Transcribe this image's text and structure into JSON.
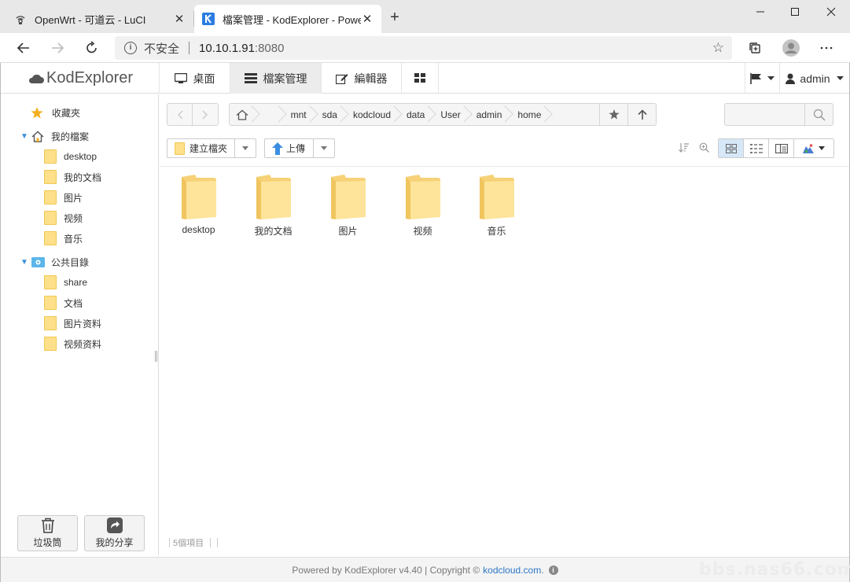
{
  "browser": {
    "tabs": [
      {
        "title": "OpenWrt - 可道云 - LuCI",
        "active": false
      },
      {
        "title": "檔案管理 - KodExplorer - Powere",
        "active": true
      }
    ],
    "new_tab_symbol": "+",
    "window_controls": {
      "minimize": "–",
      "maximize": "☐",
      "close": "✕"
    },
    "address": {
      "security_label": "不安全",
      "host": "10.10.1.91",
      "port": ":8080"
    }
  },
  "app": {
    "logo_text": "KodExplorer",
    "nav_tabs": [
      {
        "label": "桌面",
        "icon": "desktop-icon"
      },
      {
        "label": "檔案管理",
        "icon": "file-manager-icon",
        "active": true
      },
      {
        "label": "編輯器",
        "icon": "edit-icon"
      },
      {
        "label": "",
        "icon": "grid-apps-icon"
      }
    ],
    "user": {
      "name": "admin"
    }
  },
  "sidebar": {
    "favorites_label": "收藏夾",
    "my_files_label": "我的檔案",
    "my_files_children": [
      "desktop",
      "我的文档",
      "图片",
      "视频",
      "音乐"
    ],
    "public_label": "公共目錄",
    "public_children": [
      "share",
      "文档",
      "图片资料",
      "视频资料"
    ],
    "footer": {
      "recycle_label": "垃圾筒",
      "share_label": "我的分享"
    }
  },
  "breadcrumb": [
    "mnt",
    "sda",
    "kodcloud",
    "data",
    "User",
    "admin",
    "home"
  ],
  "toolbar": {
    "new_folder_label": "建立檔夾",
    "upload_label": "上傳"
  },
  "files": [
    {
      "name": "desktop"
    },
    {
      "name": "我的文档"
    },
    {
      "name": "图片"
    },
    {
      "name": "视频"
    },
    {
      "name": "音乐"
    }
  ],
  "status": {
    "count_label": "5個項目"
  },
  "footer": {
    "text": "Powered by KodExplorer v4.40 | Copyright ©",
    "link": "kodcloud.com",
    "dot": ".",
    "watermark": "bbs.nas66.com"
  },
  "colors": {
    "folder": "#ffe08a",
    "accent": "#2e76c3",
    "active_view": "#d6e8f8"
  }
}
